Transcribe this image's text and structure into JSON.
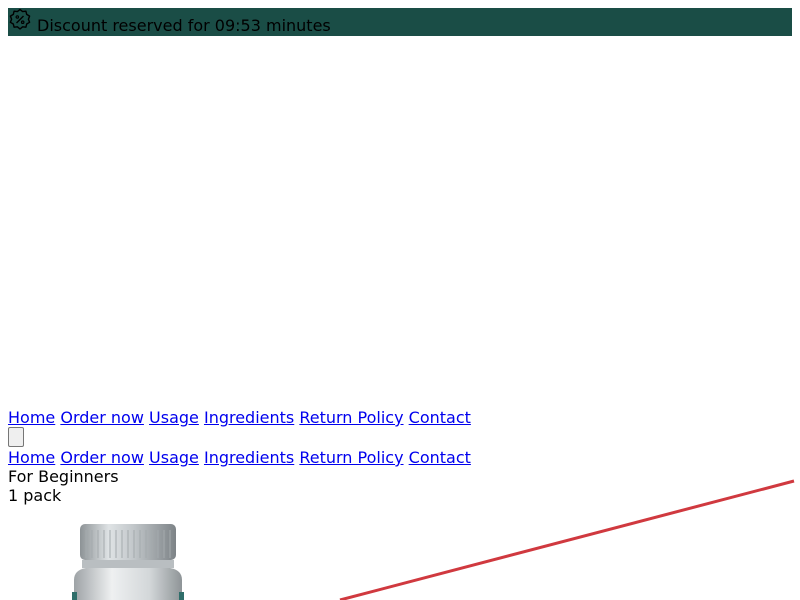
{
  "banner": {
    "icon": "discount-badge-icon",
    "text": "Discount reserved for 09:53 minutes",
    "background": "#1a4d46"
  },
  "nav_top": {
    "items": [
      "Home",
      "Order now",
      "Usage",
      "Ingredients",
      "Return Policy",
      "Contact"
    ]
  },
  "nav_mobile": {
    "items": [
      "Home",
      "Order now",
      "Usage",
      "Ingredients",
      "Return Policy",
      "Contact"
    ]
  },
  "offer": {
    "title": "For Beginners",
    "subtitle": "1 pack",
    "image": "supplement-bottle",
    "strike_color": "#d0393f"
  }
}
